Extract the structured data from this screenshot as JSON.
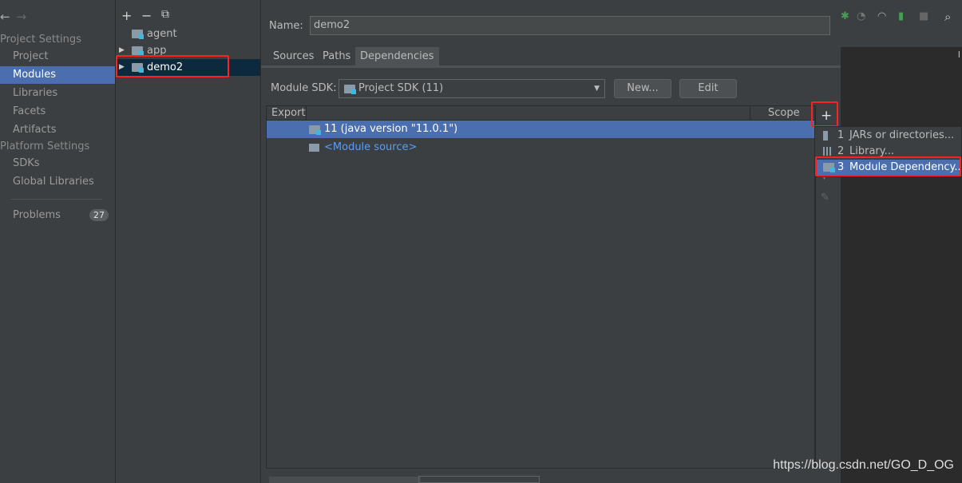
{
  "sidebar": {
    "nav_back": "←",
    "nav_forward": "→",
    "project_settings_title": "Project Settings",
    "project_items": [
      "Project",
      "Modules",
      "Libraries",
      "Facets",
      "Artifacts"
    ],
    "platform_settings_title": "Platform Settings",
    "platform_items": [
      "SDKs",
      "Global Libraries"
    ],
    "problems_label": "Problems",
    "problems_count": "27",
    "selected": "Modules"
  },
  "tree": {
    "toolbar": {
      "add": "+",
      "remove": "−",
      "copy": "⧉"
    },
    "modules": [
      {
        "name": "agent",
        "expandable": false
      },
      {
        "name": "app",
        "expandable": true
      },
      {
        "name": "demo2",
        "expandable": true,
        "selected": true
      }
    ]
  },
  "main": {
    "name_label": "Name:",
    "name_value": "demo2",
    "tabs": [
      "Sources",
      "Paths",
      "Dependencies"
    ],
    "active_tab": "Dependencies",
    "sdk_label": "Module SDK:",
    "sdk_value": "Project SDK (11)",
    "new_button": "New...",
    "edit_button": "Edit",
    "table": {
      "col_export": "Export",
      "col_scope": "Scope",
      "rows": [
        {
          "label": "11 (java version \"11.0.1\")",
          "selected": true
        },
        {
          "label": "<Module source>",
          "selected": false
        }
      ]
    },
    "add_button": "+"
  },
  "popup": {
    "items": [
      {
        "num": "1",
        "label": "JARs or directories..."
      },
      {
        "num": "2",
        "label": "Library..."
      },
      {
        "num": "3",
        "label": "Module Dependency...",
        "selected": true
      }
    ]
  },
  "watermark": "https://blog.csdn.net/GO_D_OG",
  "colors": {
    "selection": "#4b6eaf",
    "highlight": "#ff2020",
    "background": "#3c3f41"
  }
}
